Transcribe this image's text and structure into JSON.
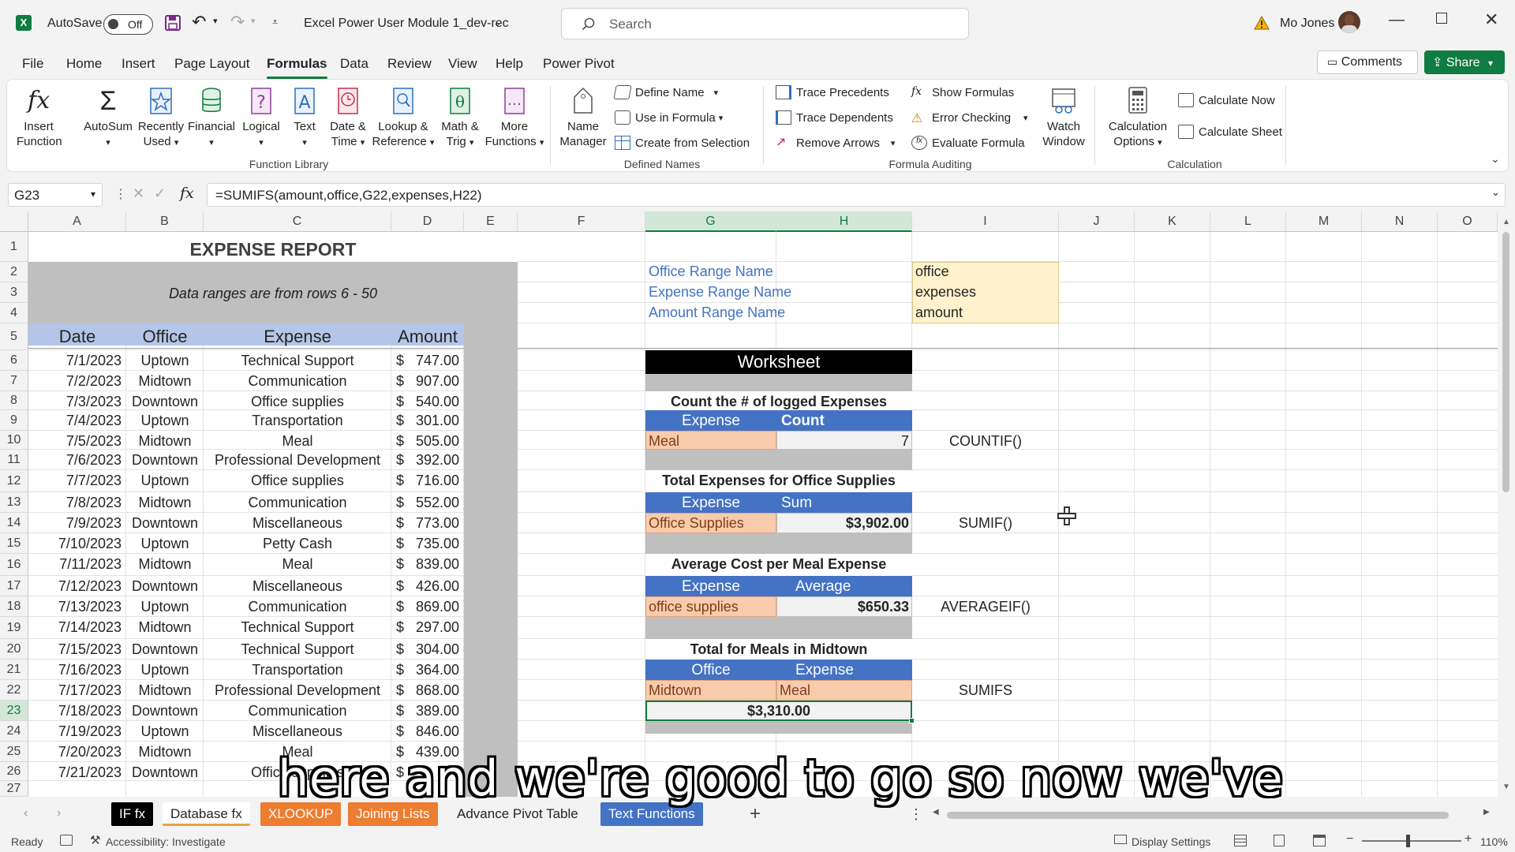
{
  "titlebar": {
    "autosave_label": "AutoSave",
    "autosave_state": "Off",
    "filename": "Excel Power User Module 1_dev-rec",
    "search_placeholder": "Search",
    "user_name": "Mo Jones",
    "app_icon": "excel-logo-icon"
  },
  "menu": {
    "items": [
      "File",
      "Home",
      "Insert",
      "Page Layout",
      "Formulas",
      "Data",
      "Review",
      "View",
      "Help",
      "Power Pivot"
    ],
    "active": "Formulas",
    "comments": "Comments",
    "share": "Share"
  },
  "ribbon": {
    "function_library": {
      "label": "Function Library",
      "buttons": [
        {
          "l1": "Insert",
          "l2": "Function"
        },
        {
          "l1": "AutoSum",
          "l2": ""
        },
        {
          "l1": "Recently",
          "l2": "Used"
        },
        {
          "l1": "Financial",
          "l2": ""
        },
        {
          "l1": "Logical",
          "l2": ""
        },
        {
          "l1": "Text",
          "l2": ""
        },
        {
          "l1": "Date &",
          "l2": "Time"
        },
        {
          "l1": "Lookup &",
          "l2": "Reference"
        },
        {
          "l1": "Math &",
          "l2": "Trig"
        },
        {
          "l1": "More",
          "l2": "Functions"
        }
      ]
    },
    "defined_names": {
      "label": "Defined Names",
      "name_manager_l1": "Name",
      "name_manager_l2": "Manager",
      "define_name": "Define Name",
      "use_in_formula": "Use in Formula",
      "create_from_selection": "Create from Selection"
    },
    "formula_auditing": {
      "label": "Formula Auditing",
      "trace_precedents": "Trace Precedents",
      "trace_dependents": "Trace Dependents",
      "remove_arrows": "Remove Arrows",
      "show_formulas": "Show Formulas",
      "error_checking": "Error Checking",
      "evaluate_formula": "Evaluate Formula",
      "watch_l1": "Watch",
      "watch_l2": "Window"
    },
    "calculation": {
      "label": "Calculation",
      "options_l1": "Calculation",
      "options_l2": "Options",
      "calc_now": "Calculate Now",
      "calc_sheet": "Calculate Sheet"
    }
  },
  "formula_bar": {
    "name_box": "G23",
    "fx": "fx",
    "formula": "=SUMIFS(amount,office,G22,expenses,H22)"
  },
  "columns": [
    "A",
    "B",
    "C",
    "D",
    "E",
    "F",
    "G",
    "H",
    "I",
    "J",
    "K",
    "L",
    "M",
    "N",
    "O"
  ],
  "rows": [
    "1",
    "2",
    "3",
    "4",
    "5",
    "6",
    "7",
    "8",
    "9",
    "10",
    "11",
    "12",
    "13",
    "14",
    "15",
    "16",
    "17",
    "18",
    "19",
    "20",
    "21",
    "22",
    "23",
    "24",
    "25",
    "26",
    "27"
  ],
  "report": {
    "title": "EXPENSE REPORT",
    "note": "Data ranges are from rows 6 - 50",
    "headers": [
      "Date",
      "Office",
      "Expense",
      "Amount"
    ],
    "rows": [
      [
        "7/1/2023",
        "Uptown",
        "Technical Support",
        "$",
        "747.00"
      ],
      [
        "7/2/2023",
        "Midtown",
        "Communication",
        "$",
        "907.00"
      ],
      [
        "7/3/2023",
        "Downtown",
        "Office supplies",
        "$",
        "540.00"
      ],
      [
        "7/4/2023",
        "Uptown",
        "Transportation",
        "$",
        "301.00"
      ],
      [
        "7/5/2023",
        "Midtown",
        "Meal",
        "$",
        "505.00"
      ],
      [
        "7/6/2023",
        "Downtown",
        "Professional Development",
        "$",
        "392.00"
      ],
      [
        "7/7/2023",
        "Uptown",
        "Office supplies",
        "$",
        "716.00"
      ],
      [
        "7/8/2023",
        "Midtown",
        "Communication",
        "$",
        "552.00"
      ],
      [
        "7/9/2023",
        "Downtown",
        "Miscellaneous",
        "$",
        "773.00"
      ],
      [
        "7/10/2023",
        "Uptown",
        "Petty Cash",
        "$",
        "735.00"
      ],
      [
        "7/11/2023",
        "Midtown",
        "Meal",
        "$",
        "839.00"
      ],
      [
        "7/12/2023",
        "Downtown",
        "Miscellaneous",
        "$",
        "426.00"
      ],
      [
        "7/13/2023",
        "Uptown",
        "Communication",
        "$",
        "869.00"
      ],
      [
        "7/14/2023",
        "Midtown",
        "Technical Support",
        "$",
        "297.00"
      ],
      [
        "7/15/2023",
        "Downtown",
        "Technical Support",
        "$",
        "304.00"
      ],
      [
        "7/16/2023",
        "Uptown",
        "Transportation",
        "$",
        "364.00"
      ],
      [
        "7/17/2023",
        "Midtown",
        "Professional Development",
        "$",
        "868.00"
      ],
      [
        "7/18/2023",
        "Downtown",
        "Communication",
        "$",
        "389.00"
      ],
      [
        "7/19/2023",
        "Uptown",
        "Miscellaneous",
        "$",
        "846.00"
      ],
      [
        "7/20/2023",
        "Midtown",
        "Meal",
        "$",
        "439.00"
      ],
      [
        "7/21/2023",
        "Downtown",
        "Office supplies",
        "$",
        ""
      ]
    ]
  },
  "range_names": [
    {
      "label": "Office Range Name",
      "value": "office"
    },
    {
      "label": "Expense Range Name",
      "value": "expenses"
    },
    {
      "label": "Amount Range Name",
      "value": "amount"
    }
  ],
  "worksheet": {
    "title": "Worksheet",
    "blocks": [
      {
        "title": "Count the # of logged Expenses",
        "h1": "Expense",
        "h2": "Count",
        "v1": "Meal",
        "v2": "7",
        "fn": "COUNTIF()"
      },
      {
        "title": "Total Expenses for Office Supplies",
        "h1": "Expense",
        "h2": "Sum",
        "v1": "Office Supplies",
        "v2": "$3,902.00",
        "fn": "SUMIF()"
      },
      {
        "title": "Average Cost per Meal Expense",
        "h1": "Expense",
        "h2": "Average",
        "v1": "office supplies",
        "v2": "$650.33",
        "fn": "AVERAGEIF()"
      },
      {
        "title": "Total  for Meals in Midtown",
        "h1": "Office",
        "h2": "Expense",
        "v1": "Midtown",
        "v2": "Meal",
        "fn": "SUMIFS",
        "result": "$3,310.00"
      }
    ]
  },
  "tabs": [
    {
      "label": "IF fx",
      "style": "dark"
    },
    {
      "label": "Database fx",
      "style": "active"
    },
    {
      "label": "XLOOKUP",
      "style": "orange"
    },
    {
      "label": "Joining Lists",
      "style": "orange"
    },
    {
      "label": "Advance Pivot Table",
      "style": "plain"
    },
    {
      "label": "Text Functions",
      "style": "blue"
    }
  ],
  "status": {
    "ready": "Ready",
    "accessibility": "Accessibility: Investigate",
    "display_settings": "Display Settings",
    "zoom": "110%"
  },
  "caption": "here and we're good to go so now we've",
  "colors": {
    "excel_green": "#107c41",
    "header_blue": "#4472c4",
    "input_orange": "#f8cbad",
    "range_yellow": "#fff2cc",
    "report_gray": "#bfbfbf",
    "header_lavender": "#b4c6e7"
  }
}
